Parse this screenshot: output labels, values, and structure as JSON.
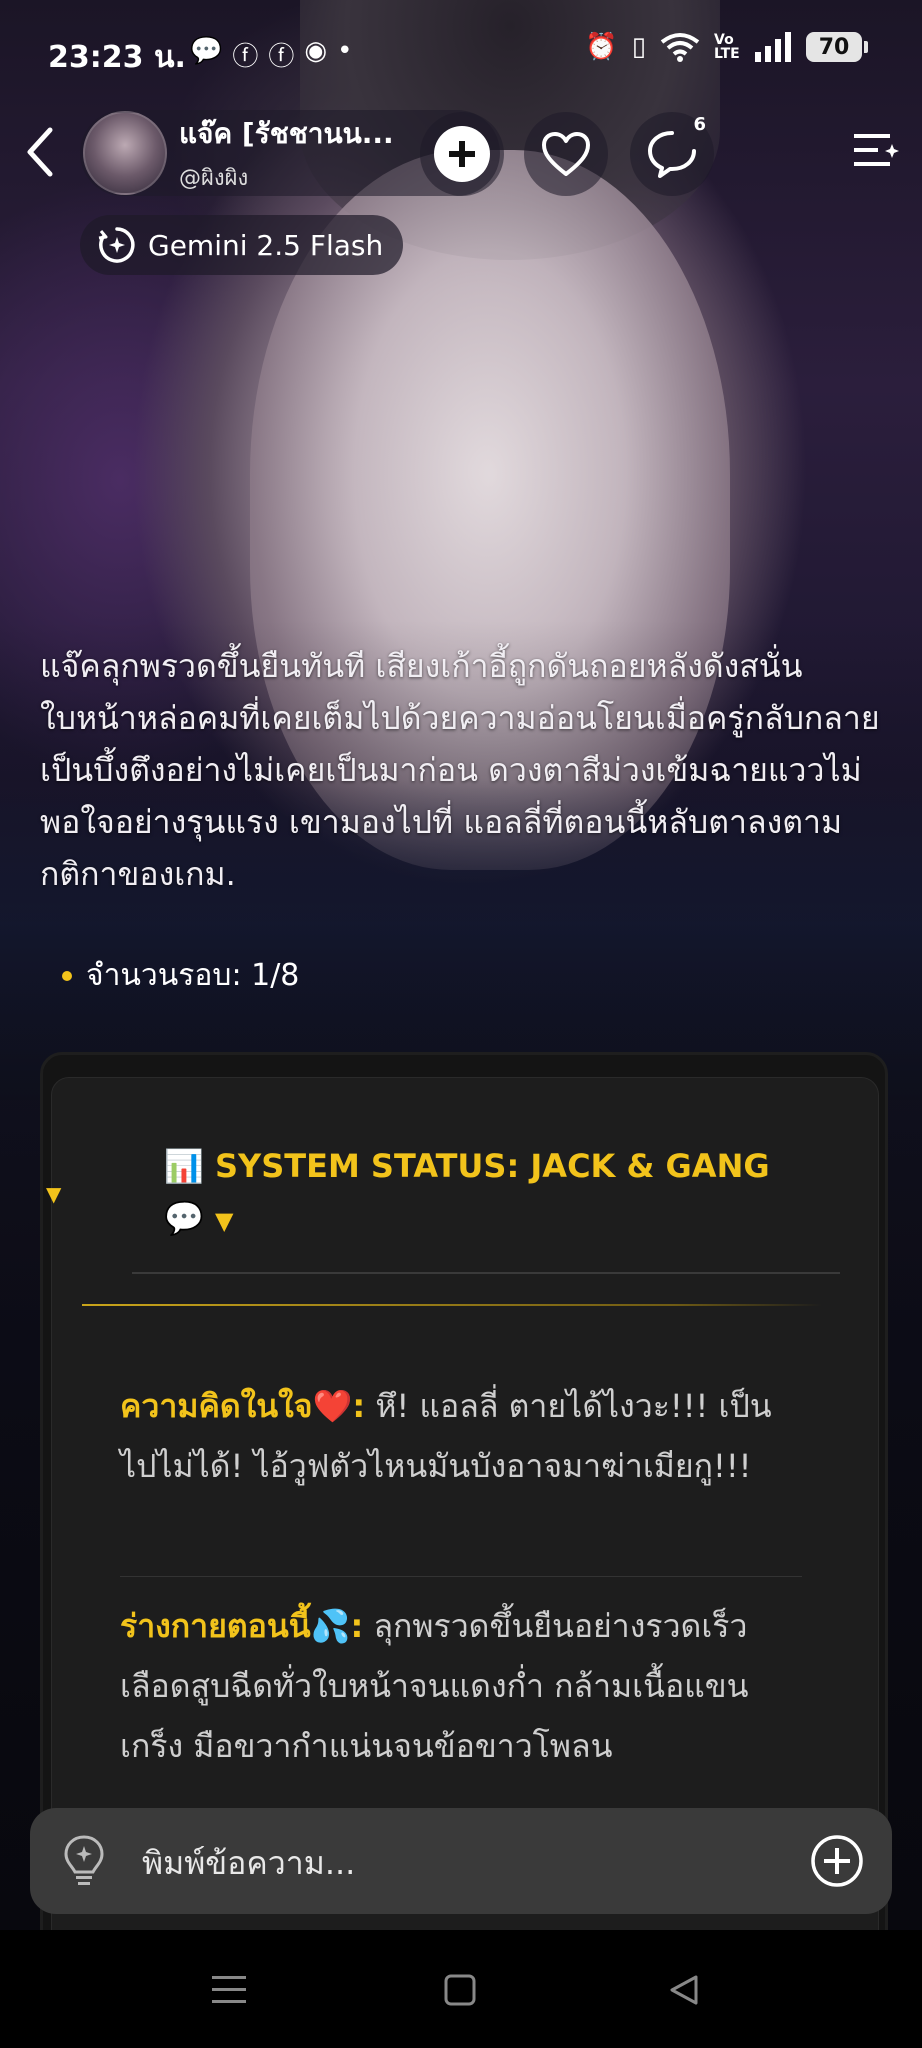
{
  "status_bar": {
    "time": "23:23 น.",
    "battery": "70",
    "network_label": "Vo LTE"
  },
  "header": {
    "character_name": "แจ๊ค [รัชชานน...",
    "character_handle": "@ผิงผิง",
    "message_badge": "6"
  },
  "model": {
    "label": "Gemini 2.5 Flash"
  },
  "narrative": {
    "text": "แจ๊คลุกพรวดขึ้นยืนทันที เสียงเก้าอี้ถูกดันถอยหลังดังสนั่น ใบหน้าหล่อคมที่เคยเต็มไปด้วยความอ่อนโยนเมื่อครู่กลับกลายเป็นบึ้งตึงอย่างไม่เคยเป็นมาก่อน ดวงตาสีม่วงเข้มฉายแววไม่พอใจอย่างรุนแรง เขามองไปที่ แอลลี่ที่ตอนนี้หลับตาลงตามกติกาของเกม.",
    "round_label": "จำนวนรอบ: 1/8"
  },
  "status_card": {
    "title_icon": "📊",
    "title": "SYSTEM STATUS: JACK & GANG",
    "title_end": "💬",
    "caret": "▼",
    "thought_label": "ความคิดในใจ❤️:",
    "thought_text": " หึ! แอลลี่ ตายได้ไงวะ!!! เป็นไปไม่ได้! ไอ้วูฟตัวไหนมันบังอาจมาฆ่าเมียกู!!!",
    "body_label": "ร่างกายตอนนี้💦:",
    "body_text": " ลุกพรวดขึ้นยืนอย่างรวดเร็ว เลือดสูบฉีดทั่วใบหน้าจนแดงก่ำ กล้ามเนื้อแขนเกร็ง มือขวากำแน่นจนข้อขาวโพลน"
  },
  "input": {
    "placeholder": "พิมพ์ข้อความ..."
  },
  "colors": {
    "accent": "#f2c31b",
    "input_bg": "#3a3a3a",
    "card_bg": "#1d1d1d"
  }
}
